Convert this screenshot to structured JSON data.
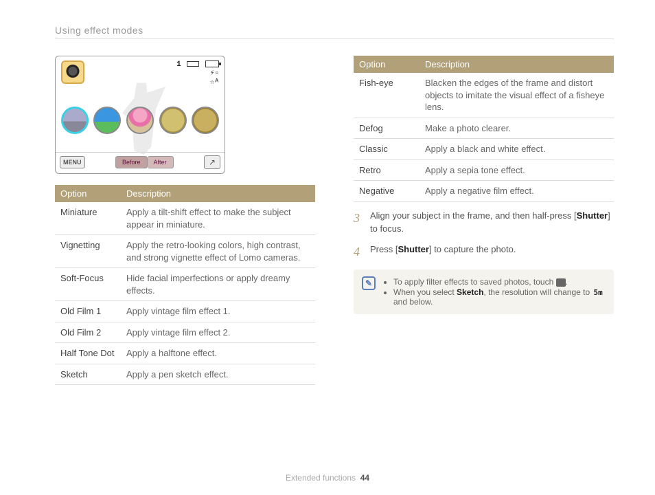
{
  "header": {
    "title": "Using effect modes"
  },
  "lcd": {
    "indicator_number": "1",
    "menu_label": "MENU",
    "before_label": "Before",
    "after_label": "After"
  },
  "table_left": {
    "headers": [
      "Option",
      "Description"
    ],
    "rows": [
      {
        "option": "Miniature",
        "desc": "Apply a tilt-shift effect to make the subject appear in miniature."
      },
      {
        "option": "Vignetting",
        "desc": "Apply the retro-looking colors, high contrast, and strong vignette effect of Lomo cameras."
      },
      {
        "option": "Soft-Focus",
        "desc": "Hide facial imperfections or apply dreamy effects."
      },
      {
        "option": "Old Film 1",
        "desc": "Apply vintage film effect 1."
      },
      {
        "option": "Old Film 2",
        "desc": "Apply vintage film effect 2."
      },
      {
        "option": "Half Tone Dot",
        "desc": "Apply a halftone effect."
      },
      {
        "option": "Sketch",
        "desc": "Apply a pen sketch effect."
      }
    ]
  },
  "table_right": {
    "headers": [
      "Option",
      "Description"
    ],
    "rows": [
      {
        "option": "Fish-eye",
        "desc": "Blacken the edges of the frame and distort objects to imitate the visual effect of a fisheye lens."
      },
      {
        "option": "Defog",
        "desc": "Make a photo clearer."
      },
      {
        "option": "Classic",
        "desc": "Apply a black and white effect."
      },
      {
        "option": "Retro",
        "desc": "Apply a sepia tone effect."
      },
      {
        "option": "Negative",
        "desc": "Apply a negative film effect."
      }
    ]
  },
  "steps": {
    "s3": {
      "num": "3",
      "pre": "Align your subject in the frame, and then half-press [",
      "bold": "Shutter",
      "post": "] to focus."
    },
    "s4": {
      "num": "4",
      "pre": "Press [",
      "bold": "Shutter",
      "post": "] to capture the photo."
    }
  },
  "note": {
    "line1_pre": "To apply filter effects to saved photos, touch ",
    "line1_post": ".",
    "line2_pre": "When you select ",
    "line2_bold": "Sketch",
    "line2_mid": ", the resolution will change to ",
    "line2_sm": "5m",
    "line2_post": " and below."
  },
  "footer": {
    "section": "Extended functions",
    "page": "44"
  }
}
